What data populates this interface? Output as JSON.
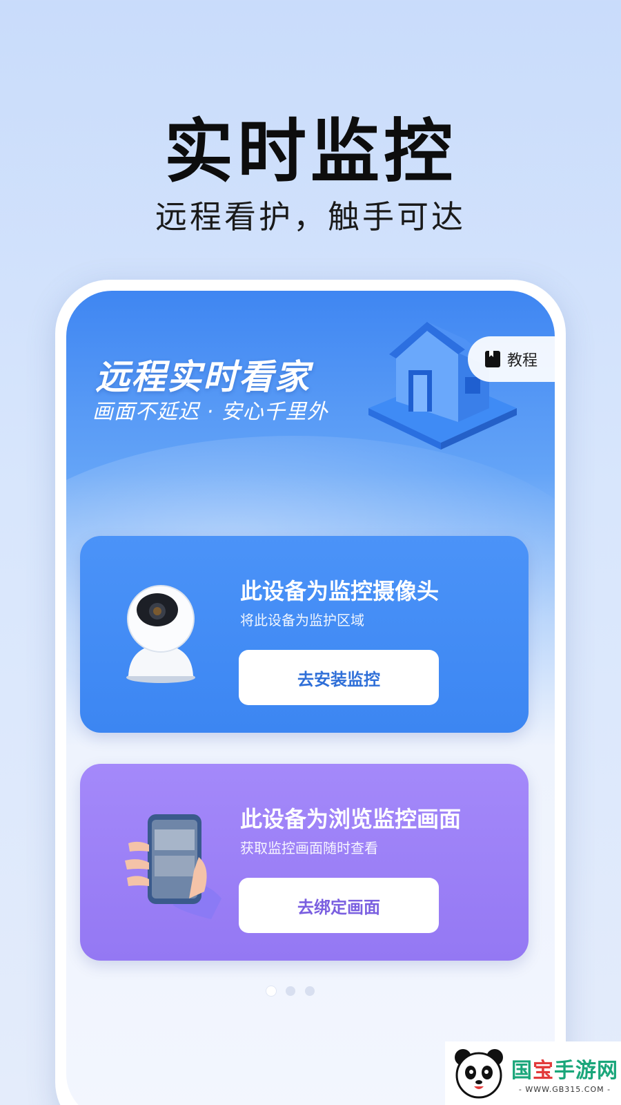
{
  "headline": "实时监控",
  "subheadline": "远程看护，触手可达",
  "app": {
    "hero_title": "远程实时看家",
    "hero_subtitle": "画面不延迟 · 安心千里外",
    "tutorial_label": "教程",
    "cards": [
      {
        "title": "此设备为监控摄像头",
        "description": "将此设备为监护区域",
        "button_label": "去安装监控",
        "color": "#3f89f5"
      },
      {
        "title": "此设备为浏览监控画面",
        "description": "获取监控画面随时查看",
        "button_label": "去绑定画面",
        "color": "#9b80f7"
      }
    ],
    "page_indicator": {
      "total": 3,
      "active": 1
    }
  },
  "watermark": {
    "logo_left": "国",
    "logo_red": "宝",
    "logo_right": "手游网",
    "url": "- WWW.GB315.COM -"
  }
}
